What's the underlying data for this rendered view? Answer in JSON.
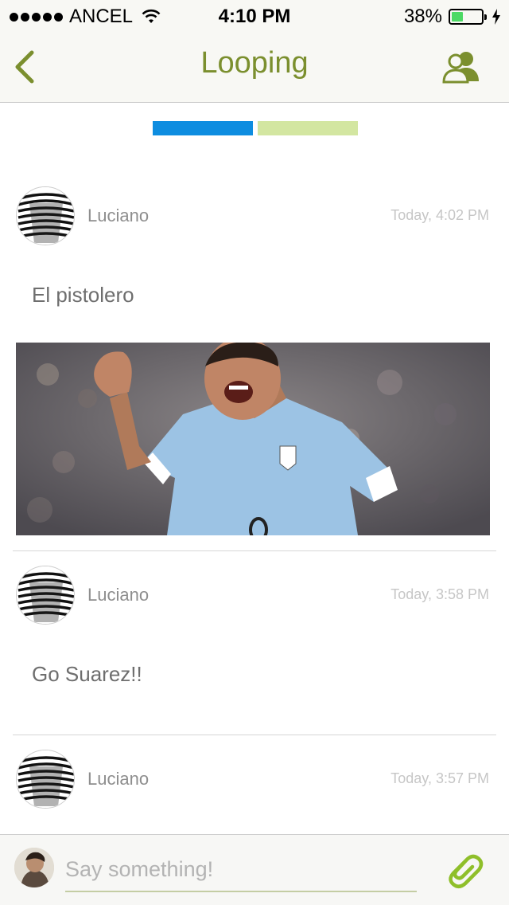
{
  "status_bar": {
    "carrier": "ANCEL",
    "time": "4:10 PM",
    "battery_percent": "38%",
    "battery_level": 0.38,
    "battery_color": "#4cd964"
  },
  "nav": {
    "title": "Looping",
    "back_icon": "chevron-left-icon",
    "members_icon": "users-icon",
    "accent": "#7b8f2e"
  },
  "page_indicator": {
    "segments": [
      {
        "color": "#0e8de0",
        "active": true
      },
      {
        "color": "#d3e6a1",
        "active": false
      }
    ]
  },
  "posts": [
    {
      "author": "Luciano",
      "timestamp": "Today, 4:02 PM",
      "text": "El pistolero",
      "has_image": true
    },
    {
      "author": "Luciano",
      "timestamp": "Today, 3:58 PM",
      "text": "Go Suarez!!",
      "has_image": false
    },
    {
      "author": "Luciano",
      "timestamp": "Today, 3:57 PM",
      "text": "",
      "has_image": false
    }
  ],
  "composer": {
    "placeholder": "Say something!",
    "attach_icon": "paperclip-icon"
  }
}
